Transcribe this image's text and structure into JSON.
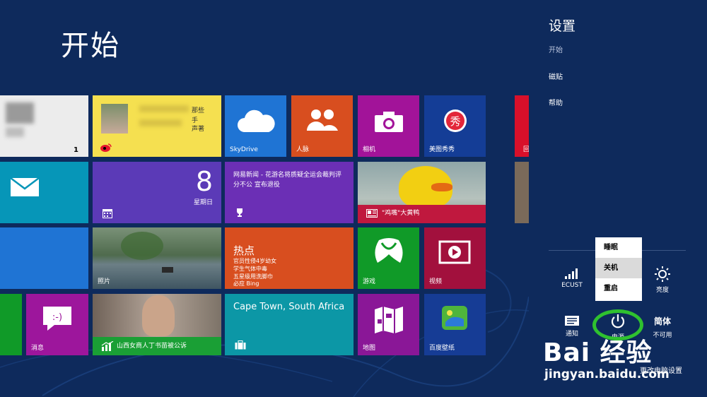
{
  "start": {
    "title": "开始"
  },
  "tiles": {
    "people_label": "人脉",
    "skydrive_label": "SkyDrive",
    "camera_label": "相机",
    "meitu_label": "美图秀秀",
    "photo_badge": "1",
    "weibo_lines": [
      "那些",
      "手"
    ],
    "weibo_tail": "声著",
    "calendar_day": "8",
    "calendar_weekday": "星期日",
    "news_text": "网易新闻 - 花游名将质疑全运会裁判评分不公 宣布退役",
    "duck_label": "\"鸡嘴\"大黄鸭",
    "photos_label": "照片",
    "hot_title": "热点",
    "hot_lines": [
      "官员性侵4岁幼女",
      "学生气体中毒",
      "五星级用洗脚巾"
    ],
    "hot_source": "必应 Bing",
    "games_label": "游戏",
    "video_label": "视频",
    "messaging_label": "消息",
    "finance_label": "山西女商人丁书苗被公诉",
    "travel_title": "Cape Town, South Africa",
    "maps_label": "地图",
    "wallpaper_label": "百度壁纸",
    "partial_label": "回"
  },
  "charms": {
    "title": "设置",
    "sub": "开始",
    "links": [
      "磁贴",
      "帮助"
    ],
    "quick": {
      "network": "ECUST",
      "brightness": "亮度",
      "notify": "通知",
      "power": "电源",
      "ime_top": "简体",
      "ime_bottom": "不可用"
    },
    "power_menu": [
      "睡眠",
      "关机",
      "重启"
    ],
    "change_pc_settings": "更改电脑设置"
  },
  "watermark": {
    "brand": "Bai 经验",
    "url": "jingyan.baidu.com"
  },
  "colors": {
    "background": "#0e2a5c",
    "skydrive": "#1f74d4",
    "people": "#d84e1f",
    "camera": "#a21399",
    "meitu": "#143d96",
    "calendar": "#5b3ab7",
    "news": "#6b2fb5",
    "hot": "#d84e1f",
    "games": "#109a28",
    "video": "#a2103d",
    "messaging": "#9d169c",
    "travel": "#0c97a6",
    "maps": "#8a1797",
    "wallpaper": "#163c95",
    "mail": "#0696b8",
    "finance": "#1a9f35",
    "weibo": "#f5e050",
    "power_ring": "#2fc12f"
  }
}
